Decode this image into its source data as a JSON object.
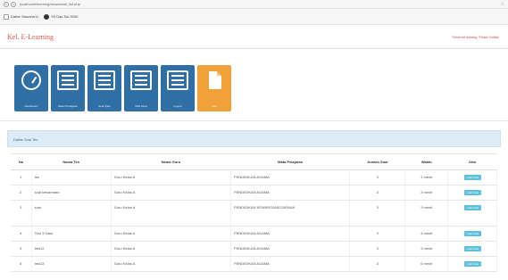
{
  "browser": {
    "url": "localhost/elearning/siswa/soal_list.php",
    "bookmarks": [
      {
        "label": "Daftar Siswa/m11"
      },
      {
        "label": "S9 Das Sul 9000"
      }
    ]
  },
  "header": {
    "brand": "Kel. E-Learning",
    "user_link": "Selamat datang, Fhaal Hafidz"
  },
  "tiles": [
    {
      "label": "Dashboard",
      "icon": "gauge-icon",
      "color": "#2f6fa5"
    },
    {
      "label": "Materi Pelajaran",
      "icon": "list-icon",
      "color": "#2f6fa5"
    },
    {
      "label": "Soal Ujian",
      "icon": "list-icon",
      "color": "#2f6fa5"
    },
    {
      "label": "Nilai Saya",
      "icon": "list-icon",
      "color": "#2f6fa5"
    },
    {
      "label": "Logout",
      "icon": "list-icon",
      "color": "#2f6fa5"
    },
    {
      "label": "Soal",
      "icon": "document-icon",
      "color": "#f0a13a"
    }
  ],
  "list": {
    "title": "Daftar Soal Tes",
    "columns": [
      "No",
      "Nama Tes",
      "Nama Guru",
      "Mata Pelajaran",
      "Jumlah Soal",
      "Waktu",
      "Aksi"
    ],
    "rows": [
      {
        "no": "1",
        "nama": "tes",
        "guru": "Guru Kelas A",
        "mapel": "PENDIDIKAN AGAMA",
        "jumlah": "3",
        "waktu": "1 menit",
        "aksi": "Lihat Soal"
      },
      {
        "no": "2",
        "nama": "soal kewarnaan",
        "guru": "Guru Kelas A",
        "mapel": "PENDIDIKAN AGAMA",
        "jumlah": "3",
        "waktu": "3 menit",
        "aksi": "Lihat Soal"
      },
      {
        "no": "3",
        "nama": "soal",
        "guru": "Guru Kelas A",
        "mapel": "PENDIDIKAN KEWARGANEGARAAN",
        "jumlah": "3",
        "waktu": "3 menit",
        "aksi": "Lihat Soal"
      },
      {
        "no": "4",
        "nama": "Test 3 Data",
        "guru": "Guru Kelas A",
        "mapel": "PENDIDIKAN AGAMA",
        "jumlah": "3",
        "waktu": "4 menit",
        "aksi": "Lihat Soal"
      },
      {
        "no": "5",
        "nama": "test12",
        "guru": "Guru Kelas A",
        "mapel": "PENDIDIKAN AGAMA",
        "jumlah": "3",
        "waktu": "3 menit",
        "aksi": "Lihat Soal"
      },
      {
        "no": "6",
        "nama": "test13",
        "guru": "Guru Kelas A",
        "mapel": "PENDIDIKAN AGAMA",
        "jumlah": "3",
        "waktu": "6 menit",
        "aksi": "Lihat Soal"
      }
    ]
  },
  "colors": {
    "brand": "#d9534f",
    "tile_blue": "#2f6fa5",
    "tile_orange": "#f0a13a",
    "button": "#5bc0de",
    "panel_head": "#dcebf5"
  }
}
